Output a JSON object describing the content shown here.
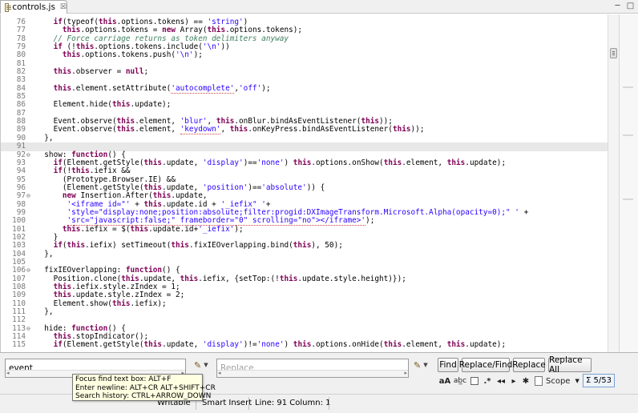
{
  "tab": {
    "title": "controls.js",
    "close": "☒"
  },
  "window": {
    "minimize": "─",
    "maximize": "□"
  },
  "editor": {
    "current_line": 91,
    "lines": [
      {
        "n": "76",
        "fold": "",
        "tokens": [
          [
            "i",
            "    "
          ],
          [
            "kw",
            "if"
          ],
          [
            "i",
            "(typeof("
          ],
          [
            "th",
            "this"
          ],
          [
            "i",
            ".options.tokens) == "
          ],
          [
            "st",
            "'string'"
          ],
          [
            "i",
            ")"
          ]
        ]
      },
      {
        "n": "77",
        "fold": "",
        "tokens": [
          [
            "i",
            "      "
          ],
          [
            "th",
            "this"
          ],
          [
            "i",
            ".options.tokens = "
          ],
          [
            "kw",
            "new"
          ],
          [
            "i",
            " Array("
          ],
          [
            "th",
            "this"
          ],
          [
            "i",
            ".options.tokens);"
          ]
        ]
      },
      {
        "n": "78",
        "fold": "",
        "tokens": [
          [
            "i",
            "    "
          ],
          [
            "cm",
            "// Force carriage returns as token delimiters anyway"
          ]
        ]
      },
      {
        "n": "79",
        "fold": "",
        "tokens": [
          [
            "i",
            "    "
          ],
          [
            "kw",
            "if"
          ],
          [
            "i",
            " (!"
          ],
          [
            "th",
            "this"
          ],
          [
            "i",
            ".options.tokens.include("
          ],
          [
            "st",
            "'\\n'"
          ],
          [
            "i",
            "))"
          ]
        ]
      },
      {
        "n": "80",
        "fold": "",
        "tokens": [
          [
            "i",
            "      "
          ],
          [
            "th",
            "this"
          ],
          [
            "i",
            ".options.tokens.push("
          ],
          [
            "st",
            "'\\n'"
          ],
          [
            "i",
            ");"
          ]
        ]
      },
      {
        "n": "81",
        "fold": "",
        "tokens": [
          [
            "i",
            ""
          ]
        ]
      },
      {
        "n": "82",
        "fold": "",
        "tokens": [
          [
            "i",
            "    "
          ],
          [
            "th",
            "this"
          ],
          [
            "i",
            ".observer = "
          ],
          [
            "kw",
            "null"
          ],
          [
            "i",
            ";"
          ]
        ]
      },
      {
        "n": "83",
        "fold": "",
        "tokens": [
          [
            "i",
            ""
          ]
        ]
      },
      {
        "n": "84",
        "fold": "",
        "tokens": [
          [
            "i",
            "    "
          ],
          [
            "th",
            "this"
          ],
          [
            "i",
            ".element.setAttribute("
          ],
          [
            "sq",
            "'autocomplete'"
          ],
          [
            "i",
            ","
          ],
          [
            "st",
            "'off'"
          ],
          [
            "i",
            ");"
          ]
        ]
      },
      {
        "n": "85",
        "fold": "",
        "tokens": [
          [
            "i",
            ""
          ]
        ]
      },
      {
        "n": "86",
        "fold": "",
        "tokens": [
          [
            "i",
            "    Element.hide("
          ],
          [
            "th",
            "this"
          ],
          [
            "i",
            ".update);"
          ]
        ]
      },
      {
        "n": "87",
        "fold": "",
        "tokens": [
          [
            "i",
            ""
          ]
        ]
      },
      {
        "n": "88",
        "fold": "",
        "tokens": [
          [
            "i",
            "    Event.observe("
          ],
          [
            "th",
            "this"
          ],
          [
            "i",
            ".element, "
          ],
          [
            "st",
            "'blur'"
          ],
          [
            "i",
            ", "
          ],
          [
            "th",
            "this"
          ],
          [
            "i",
            ".onBlur.bindAsEventListener("
          ],
          [
            "th",
            "this"
          ],
          [
            "i",
            "));"
          ]
        ]
      },
      {
        "n": "89",
        "fold": "",
        "tokens": [
          [
            "i",
            "    Event.observe("
          ],
          [
            "th",
            "this"
          ],
          [
            "i",
            ".element, "
          ],
          [
            "sq",
            "'keydown'"
          ],
          [
            "i",
            ", "
          ],
          [
            "th",
            "this"
          ],
          [
            "i",
            ".onKeyPress.bindAsEventListener("
          ],
          [
            "th",
            "this"
          ],
          [
            "i",
            "));"
          ]
        ]
      },
      {
        "n": "90",
        "fold": "",
        "tokens": [
          [
            "i",
            "  },"
          ]
        ]
      },
      {
        "n": "91",
        "fold": "",
        "tokens": [
          [
            "i",
            ""
          ]
        ]
      },
      {
        "n": "92",
        "fold": "⊖",
        "tokens": [
          [
            "i",
            "  show: "
          ],
          [
            "kw",
            "function"
          ],
          [
            "i",
            "() {"
          ]
        ]
      },
      {
        "n": "93",
        "fold": "",
        "tokens": [
          [
            "i",
            "    "
          ],
          [
            "kw",
            "if"
          ],
          [
            "i",
            "(Element.getStyle("
          ],
          [
            "th",
            "this"
          ],
          [
            "i",
            ".update, "
          ],
          [
            "st",
            "'display'"
          ],
          [
            "i",
            ")=="
          ],
          [
            "st",
            "'none'"
          ],
          [
            "i",
            ") "
          ],
          [
            "th",
            "this"
          ],
          [
            "i",
            ".options.onShow("
          ],
          [
            "th",
            "this"
          ],
          [
            "i",
            ".element, "
          ],
          [
            "th",
            "this"
          ],
          [
            "i",
            ".update);"
          ]
        ]
      },
      {
        "n": "94",
        "fold": "",
        "tokens": [
          [
            "i",
            "    "
          ],
          [
            "kw",
            "if"
          ],
          [
            "i",
            "(!"
          ],
          [
            "th",
            "this"
          ],
          [
            "i",
            ".iefix &&"
          ]
        ]
      },
      {
        "n": "95",
        "fold": "",
        "tokens": [
          [
            "i",
            "      (Prototype.Browser.IE) &&"
          ]
        ]
      },
      {
        "n": "96",
        "fold": "",
        "tokens": [
          [
            "i",
            "      (Element.getStyle("
          ],
          [
            "th",
            "this"
          ],
          [
            "i",
            ".update, "
          ],
          [
            "st",
            "'position'"
          ],
          [
            "i",
            ")=="
          ],
          [
            "st",
            "'absolute'"
          ],
          [
            "i",
            ")) {"
          ]
        ]
      },
      {
        "n": "97",
        "fold": "⊖",
        "tokens": [
          [
            "i",
            "      "
          ],
          [
            "kw",
            "new"
          ],
          [
            "i",
            " Insertion.After("
          ],
          [
            "th",
            "this"
          ],
          [
            "i",
            ".update,"
          ]
        ]
      },
      {
        "n": "98",
        "fold": "",
        "tokens": [
          [
            "i",
            "       "
          ],
          [
            "st",
            "'<iframe id=\"'"
          ],
          [
            "i",
            " + "
          ],
          [
            "th",
            "this"
          ],
          [
            "i",
            ".update.id + "
          ],
          [
            "st",
            "'_iefix\" '"
          ],
          [
            "i",
            "+"
          ]
        ]
      },
      {
        "n": "99",
        "fold": "",
        "tokens": [
          [
            "i",
            "       "
          ],
          [
            "st",
            "'style=\"display:none;position:absolute;filter:progid:DXImageTransform.Microsoft.Alpha(opacity=0);\" '"
          ],
          [
            "i",
            " +"
          ]
        ]
      },
      {
        "n": "100",
        "fold": "",
        "tokens": [
          [
            "i",
            "       "
          ],
          [
            "sq",
            "'src=\"javascript:false;\" frameborder=\"0\" scrolling=\"no\"></iframe>'"
          ],
          [
            "i",
            ");"
          ]
        ]
      },
      {
        "n": "101",
        "fold": "",
        "tokens": [
          [
            "i",
            "      "
          ],
          [
            "th",
            "this"
          ],
          [
            "i",
            ".iefix = $("
          ],
          [
            "th",
            "this"
          ],
          [
            "i",
            ".update.id+"
          ],
          [
            "st",
            "'_iefix'"
          ],
          [
            "i",
            ");"
          ]
        ]
      },
      {
        "n": "102",
        "fold": "",
        "tokens": [
          [
            "i",
            "    }"
          ]
        ]
      },
      {
        "n": "103",
        "fold": "",
        "tokens": [
          [
            "i",
            "    "
          ],
          [
            "kw",
            "if"
          ],
          [
            "i",
            "("
          ],
          [
            "th",
            "this"
          ],
          [
            "i",
            ".iefix) setTimeout("
          ],
          [
            "th",
            "this"
          ],
          [
            "i",
            ".fixIEOverlapping.bind("
          ],
          [
            "th",
            "this"
          ],
          [
            "i",
            "), 50);"
          ]
        ]
      },
      {
        "n": "104",
        "fold": "",
        "tokens": [
          [
            "i",
            "  },"
          ]
        ]
      },
      {
        "n": "105",
        "fold": "",
        "tokens": [
          [
            "i",
            ""
          ]
        ]
      },
      {
        "n": "106",
        "fold": "⊖",
        "tokens": [
          [
            "i",
            "  fixIEOverlapping: "
          ],
          [
            "kw",
            "function"
          ],
          [
            "i",
            "() {"
          ]
        ]
      },
      {
        "n": "107",
        "fold": "",
        "tokens": [
          [
            "i",
            "    Position.clone("
          ],
          [
            "th",
            "this"
          ],
          [
            "i",
            ".update, "
          ],
          [
            "th",
            "this"
          ],
          [
            "i",
            ".iefix, {setTop:(!"
          ],
          [
            "th",
            "this"
          ],
          [
            "i",
            ".update.style.height)});"
          ]
        ]
      },
      {
        "n": "108",
        "fold": "",
        "tokens": [
          [
            "i",
            "    "
          ],
          [
            "th",
            "this"
          ],
          [
            "i",
            ".iefix.style.zIndex = 1;"
          ]
        ]
      },
      {
        "n": "109",
        "fold": "",
        "tokens": [
          [
            "i",
            "    "
          ],
          [
            "th",
            "this"
          ],
          [
            "i",
            ".update.style.zIndex = 2;"
          ]
        ]
      },
      {
        "n": "110",
        "fold": "",
        "tokens": [
          [
            "i",
            "    Element.show("
          ],
          [
            "th",
            "this"
          ],
          [
            "i",
            ".iefix);"
          ]
        ]
      },
      {
        "n": "111",
        "fold": "",
        "tokens": [
          [
            "i",
            "  },"
          ]
        ]
      },
      {
        "n": "112",
        "fold": "",
        "tokens": [
          [
            "i",
            ""
          ]
        ]
      },
      {
        "n": "113",
        "fold": "⊖",
        "tokens": [
          [
            "i",
            "  hide: "
          ],
          [
            "kw",
            "function"
          ],
          [
            "i",
            "() {"
          ]
        ]
      },
      {
        "n": "114",
        "fold": "",
        "tokens": [
          [
            "i",
            "    "
          ],
          [
            "th",
            "this"
          ],
          [
            "i",
            ".stopIndicator();"
          ]
        ]
      },
      {
        "n": "115",
        "fold": "",
        "tokens": [
          [
            "i",
            "    "
          ],
          [
            "kw",
            "if"
          ],
          [
            "i",
            "(Element.getStyle("
          ],
          [
            "th",
            "this"
          ],
          [
            "i",
            ".update, "
          ],
          [
            "st",
            "'display'"
          ],
          [
            "i",
            ")!="
          ],
          [
            "st",
            "'none'"
          ],
          [
            "i",
            ") "
          ],
          [
            "th",
            "this"
          ],
          [
            "i",
            ".options.onHide("
          ],
          [
            "th",
            "this"
          ],
          [
            "i",
            ".element, "
          ],
          [
            "th",
            "this"
          ],
          [
            "i",
            ".update);"
          ]
        ]
      }
    ]
  },
  "find": {
    "find_value": "event",
    "replace_placeholder": "Replace",
    "find_button": "Find",
    "replace_find_button": "Replace/Find",
    "replace_button": "Replace",
    "replace_all_button": "Replace All",
    "options": {
      "case_sensitive": "aA",
      "whole_word": "ab̲c",
      "regex": ".*",
      "prev": "◂◂",
      "next": "▸",
      "settings": "✱"
    },
    "scope_label": "Scope",
    "count": "Σ 5/53"
  },
  "tooltip": {
    "lines": [
      "Focus find text box: ALT+F",
      "Enter newline: ALT+CR ALT+SHIFT+CR",
      "Search history: CTRL+ARROW_DOWN"
    ]
  },
  "status": {
    "writable": "Writable",
    "insert_mode": "Smart Insert",
    "position": "Line: 91 Column: 1"
  }
}
